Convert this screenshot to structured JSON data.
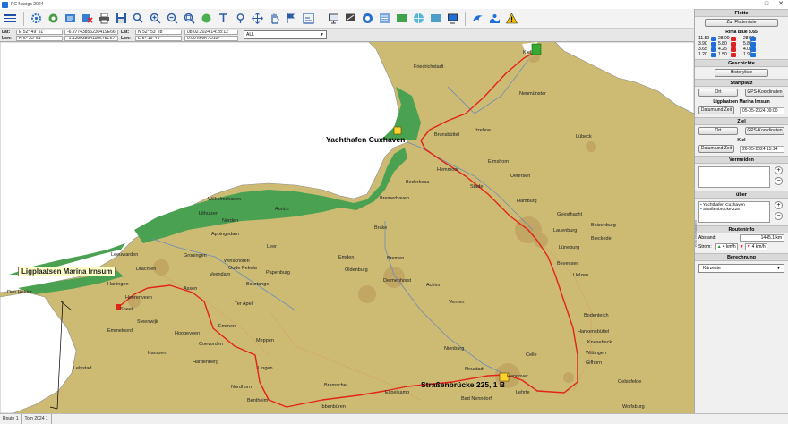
{
  "window": {
    "title": "PC Navigo 2024",
    "minimize": "—",
    "maximize": "□",
    "close": "✕"
  },
  "toolbar": {
    "icons": [
      "settings-icon",
      "routes-icon",
      "layers-icon",
      "delete-route-icon",
      "print-icon",
      "save-icon",
      "zoom-dropdown-icon",
      "zoom-in-icon",
      "zoom-out-icon",
      "fit-icon",
      "circle-icon",
      "text-icon",
      "pin-icon",
      "crosshair-icon",
      "hand-icon",
      "flag-icon",
      "ruler-icon",
      "monitor-icon",
      "monitor-ais-icon",
      "compass-icon",
      "list-icon",
      "layers2-icon",
      "globe-icon",
      "nmea-icon",
      "screen-icon",
      "wave-icon",
      "water-icon",
      "warning-icon"
    ]
  },
  "infobar": {
    "lat_label": "Lat:",
    "lon_label": "Lon:",
    "lat1": "E 52° 49' 51\"",
    "lon1": "N 5° 22' 51\"",
    "lat2": "-6.27743856230419E66",
    "lon2": "-1.12993894119675E67",
    "lat3_label": "Lat:",
    "lon3_label": "Lon:",
    "lat3": "N 52° 53' 28\"",
    "lon3": "E 5° 19' 44\"",
    "datetime": "08.02.2024 14:28:12",
    "speed": "0.00 km/h / 210°",
    "filter": "ALL"
  },
  "map": {
    "labels": {
      "kiel": "Kiel",
      "cuxhaven_marina": "Yachthafen Cuxhaven",
      "start_label": "Ligplaatsen Marina Irnsum",
      "strassenbruecke": "Straßenbrücke 225, 1 B",
      "friedrichstadt": "Friedrichstadt",
      "neumuenster": "Neumünster",
      "brunsbuettel": "Brunsbüttel",
      "itzehoe": "Itzehoe",
      "hemmoor": "Hemmoor",
      "elmshorn": "Elmshorn",
      "luebeck": "Lübeck",
      "bederkesa": "Bederkesa",
      "uetersen": "Uetersen",
      "stade": "Stade",
      "hamburg": "Hamburg",
      "geesthacht": "Geesthacht",
      "boizenburg": "Boizenburg",
      "bleckede": "Bleckede",
      "lueneburg": "Lüneburg",
      "wilhelmshaven": "Wilhelmshaven",
      "bremerhaven": "Bremerhaven",
      "aurich": "Aurich",
      "leer": "Leer",
      "brake": "Brake",
      "oldenburg": "Oldenburg",
      "delmenhorst": "Delmenhorst",
      "bremen": "Bremen",
      "papenburg": "Papenburg",
      "emden": "Emden",
      "verden": "Verden",
      "achim": "Achim",
      "nienburg": "Nienburg",
      "celle": "Celle",
      "wolfsburg": "Wolfsburg",
      "gifhorn": "Gifhorn",
      "neustadt": "Neustadt",
      "hannover": "Hannover",
      "lehrte": "Lehrte",
      "bad_nenndorf": "Bad Nenndorf",
      "espelkamp": "Espelkamp",
      "bramsche": "Bramsche",
      "lingen": "Lingen",
      "meppen": "Meppen",
      "ter_apel": "Ter Apel",
      "emmen": "Emmen",
      "coevorden": "Coevorden",
      "hoogeveen": "Hoogeveen",
      "assen": "Assen",
      "groningen": "Groningen",
      "veendam": "Veendam",
      "drachten": "Drachten",
      "leeuwarden": "Leeuwarden",
      "heerenveen": "Heerenveen",
      "steenwijk": "Steenwijk",
      "den_helder": "Den Helder",
      "lelystad": "Lelystad",
      "hardenberg": "Hardenberg",
      "nordhorn": "Nordhorn",
      "bentheim": "Bentheim",
      "ibbenbueren": "Ibbenbüren",
      "lauenburg": "Lauenburg",
      "bevensen": "Bevensen",
      "uelzen": "Uelzen",
      "bodenteich": "Bodenteich",
      "hankensbuettel": "Hankensbüttel",
      "knesebeck": "Knesebeck",
      "wittingen": "Wittingen",
      "oebisfelde": "Oebisfelde",
      "norden": "Norden",
      "lithuizen": "Lithuizen",
      "appingedam": "Appingedam",
      "winschoten": "Winschoten",
      "oude_pekela": "Oude Pekela",
      "bourtange": "Bourtange",
      "harlingen": "Harlingen",
      "sneek": "Sneek",
      "emmeloord": "Emmeloord",
      "kampen": "Kampen"
    }
  },
  "panel": {
    "flotte": {
      "header": "Flotte",
      "button": "Zur Flottenliste",
      "boat": "Rima Blue 3.65",
      "tidal": [
        {
          "l": "11.50",
          "r1": "28.00",
          "r2": "28.00"
        },
        {
          "l": "3.90",
          "r1": "5.80",
          "r2": "5.80"
        },
        {
          "l": "3.65",
          "r1": "4.25",
          "r2": "4.00"
        },
        {
          "l": "1.20",
          "r1": "1.50",
          "r2": "1.90"
        }
      ]
    },
    "geschichte": {
      "header": "Geschichte",
      "button": "Historyliste"
    },
    "startplatz": {
      "header": "Startplatz",
      "ort": "Ort",
      "gps": "GPS-Koordinaten",
      "name": "Ligplaatsen Marina Irnsum",
      "datum_btn": "Datum und Zeit",
      "datum": "05-05-2024 09:00"
    },
    "ziel": {
      "header": "Ziel",
      "ort": "Ort",
      "gps": "GPS-Koordinaten",
      "name": "Kiel",
      "datum_btn": "Datum und Zeit",
      "datum": "26-05-2024 15:14"
    },
    "vermeiden": {
      "header": "Vermeiden",
      "add": "+",
      "remove": "−"
    },
    "ueber": {
      "header": "über",
      "items": [
        "Yachthafen Cuxhaven",
        "Straßenbrücke 225"
      ],
      "add": "+",
      "remove": "−",
      "vtab": "Wind Informationen"
    },
    "routeninfo": {
      "header": "Routeninfo",
      "abstand_lbl": "Abstand:",
      "abstand": "1445.1 km",
      "strom_lbl": "Strom:",
      "strom1": "4 km/h",
      "strom2": "4 km/h"
    },
    "berechnung": {
      "header": "Berechnung",
      "option": "Kürzeste"
    }
  },
  "status": {
    "route": "Route 1",
    "tour": "Tom 2024 1"
  }
}
